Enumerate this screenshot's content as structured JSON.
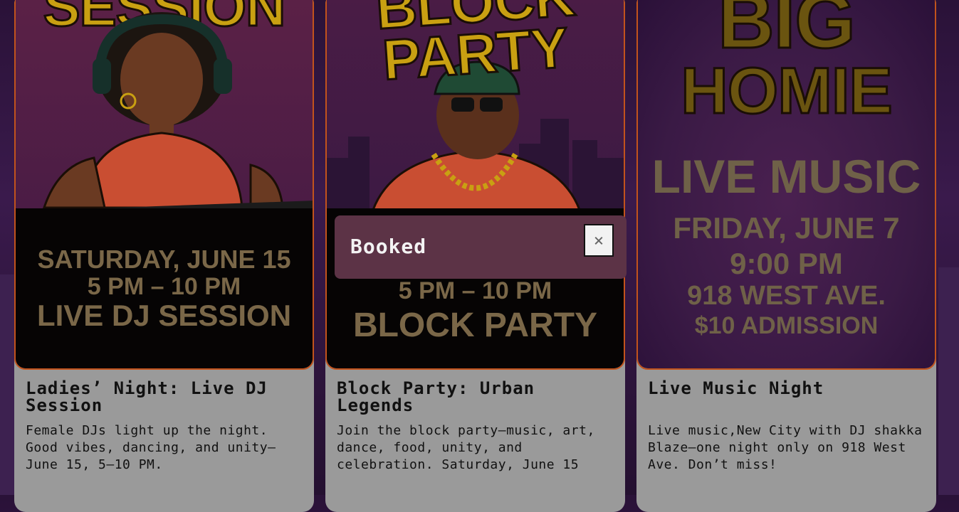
{
  "cards": [
    {
      "poster_headline": "SESSION",
      "poster_lines": [
        "SATURDAY, JUNE 15",
        "5 PM – 10 PM",
        "LIVE DJ SESSION"
      ],
      "title": "Ladies’ Night: Live DJ Session",
      "description": "Female DJs light up the night. Good vibes, dancing, and unity—June 15, 5–10 PM."
    },
    {
      "poster_headline_1": "BLOCK",
      "poster_headline_2": "PARTY",
      "poster_lines": [
        "5 PM – 10 PM",
        "BLOCK PARTY"
      ],
      "title": "Block Party: Urban Legends",
      "description": "Join the block party—music, art, dance, food, unity, and celebration. Saturday, June 15"
    },
    {
      "poster_headline_1": "BIG",
      "poster_headline_2": "HOMIE",
      "poster_lines": [
        "LIVE MUSIC",
        "FRIDAY, JUNE 7",
        "9:00 PM",
        "918 WEST AVE.",
        "$10 ADMISSION"
      ],
      "title": "Live Music Night",
      "description": "Live music,New City with DJ shakka Blaze—one night only on 918 West Ave. Don’t miss!"
    }
  ],
  "toast": {
    "message": "Booked",
    "close_glyph": "×"
  }
}
